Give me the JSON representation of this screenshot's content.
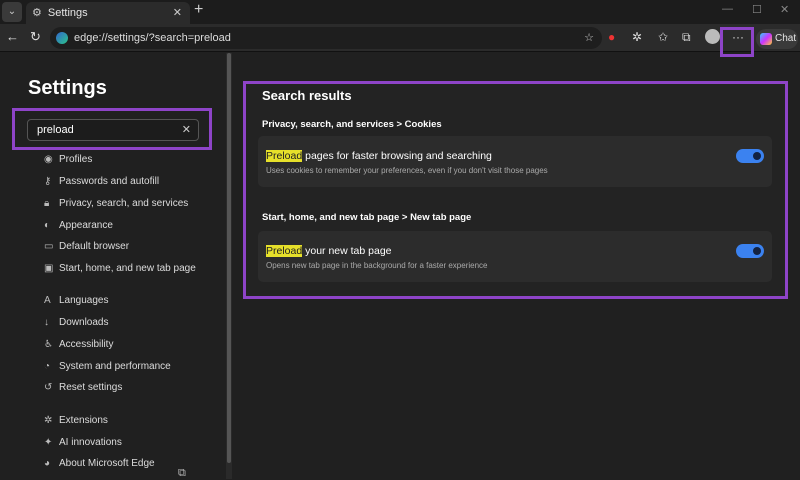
{
  "browser": {
    "tab_title": "Settings",
    "url": "edge://settings/?search=preload",
    "chat_label": "Chat"
  },
  "sidebar": {
    "title": "Settings",
    "search_value": "preload",
    "items": [
      {
        "label": "Profiles",
        "icon": "person-icon"
      },
      {
        "label": "Passwords and autofill",
        "icon": "key-icon"
      },
      {
        "label": "Privacy, search, and services",
        "icon": "lock-icon"
      },
      {
        "label": "Appearance",
        "icon": "palette-icon"
      },
      {
        "label": "Default browser",
        "icon": "browser-icon"
      },
      {
        "label": "Start, home, and new tab page",
        "icon": "home-icon"
      },
      {
        "label": "Languages",
        "icon": "language-icon"
      },
      {
        "label": "Downloads",
        "icon": "download-icon"
      },
      {
        "label": "Accessibility",
        "icon": "accessibility-icon"
      },
      {
        "label": "System and performance",
        "icon": "system-icon"
      },
      {
        "label": "Reset settings",
        "icon": "reset-icon"
      },
      {
        "label": "Extensions",
        "icon": "puzzle-icon"
      },
      {
        "label": "AI innovations",
        "icon": "ai-icon"
      },
      {
        "label": "About Microsoft Edge",
        "icon": "edge-icon"
      }
    ]
  },
  "results": {
    "title": "Search results",
    "groups": [
      {
        "breadcrumb": "Privacy, search, and services  >  Cookies",
        "highlight": "Preload",
        "title_rest": " pages for faster browsing and searching",
        "desc": "Uses cookies to remember your preferences, even if you don't visit those pages",
        "enabled": true
      },
      {
        "breadcrumb": "Start, home, and new tab page  >  New tab page",
        "highlight": "Preload",
        "title_rest": " your new tab page",
        "desc": "Opens new tab page in the background for a faster experience",
        "enabled": true
      }
    ]
  }
}
